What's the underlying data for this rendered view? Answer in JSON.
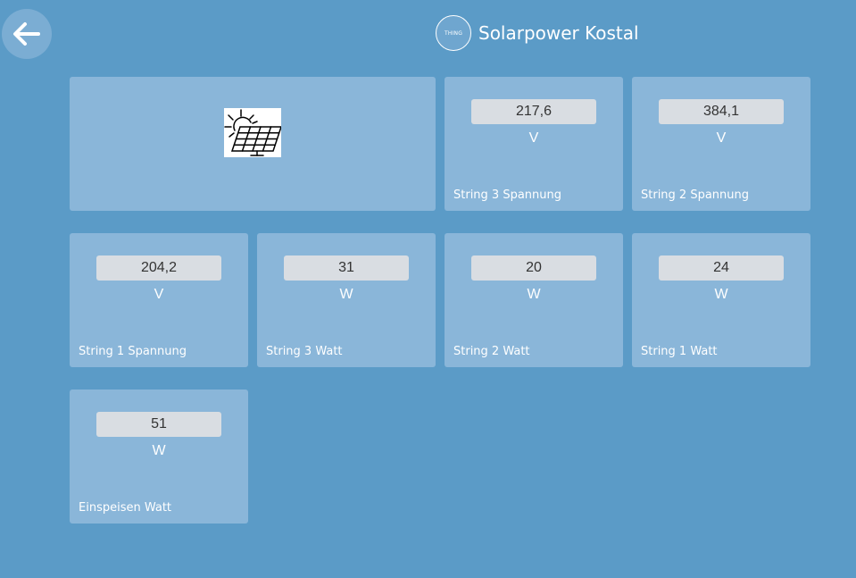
{
  "header": {
    "badge_text": "THING",
    "title": "Solarpower Kostal"
  },
  "icons": {
    "back": "arrow-left-icon",
    "solar": "solar-panel-icon"
  },
  "tiles": [
    {
      "value": "217,6",
      "unit": "V",
      "label": "String 3 Spannung"
    },
    {
      "value": "384,1",
      "unit": "V",
      "label": "String 2 Spannung"
    },
    {
      "value": "204,2",
      "unit": "V",
      "label": "String 1 Spannung"
    },
    {
      "value": "31",
      "unit": "W",
      "label": "String 3 Watt"
    },
    {
      "value": "20",
      "unit": "W",
      "label": "String 2 Watt"
    },
    {
      "value": "24",
      "unit": "W",
      "label": "String 1 Watt"
    },
    {
      "value": "51",
      "unit": "W",
      "label": "Einspeisen Watt"
    }
  ],
  "colors": {
    "background": "#5b9bc7",
    "tile": "#8ab6d9",
    "value_box": "#d9dde2"
  }
}
